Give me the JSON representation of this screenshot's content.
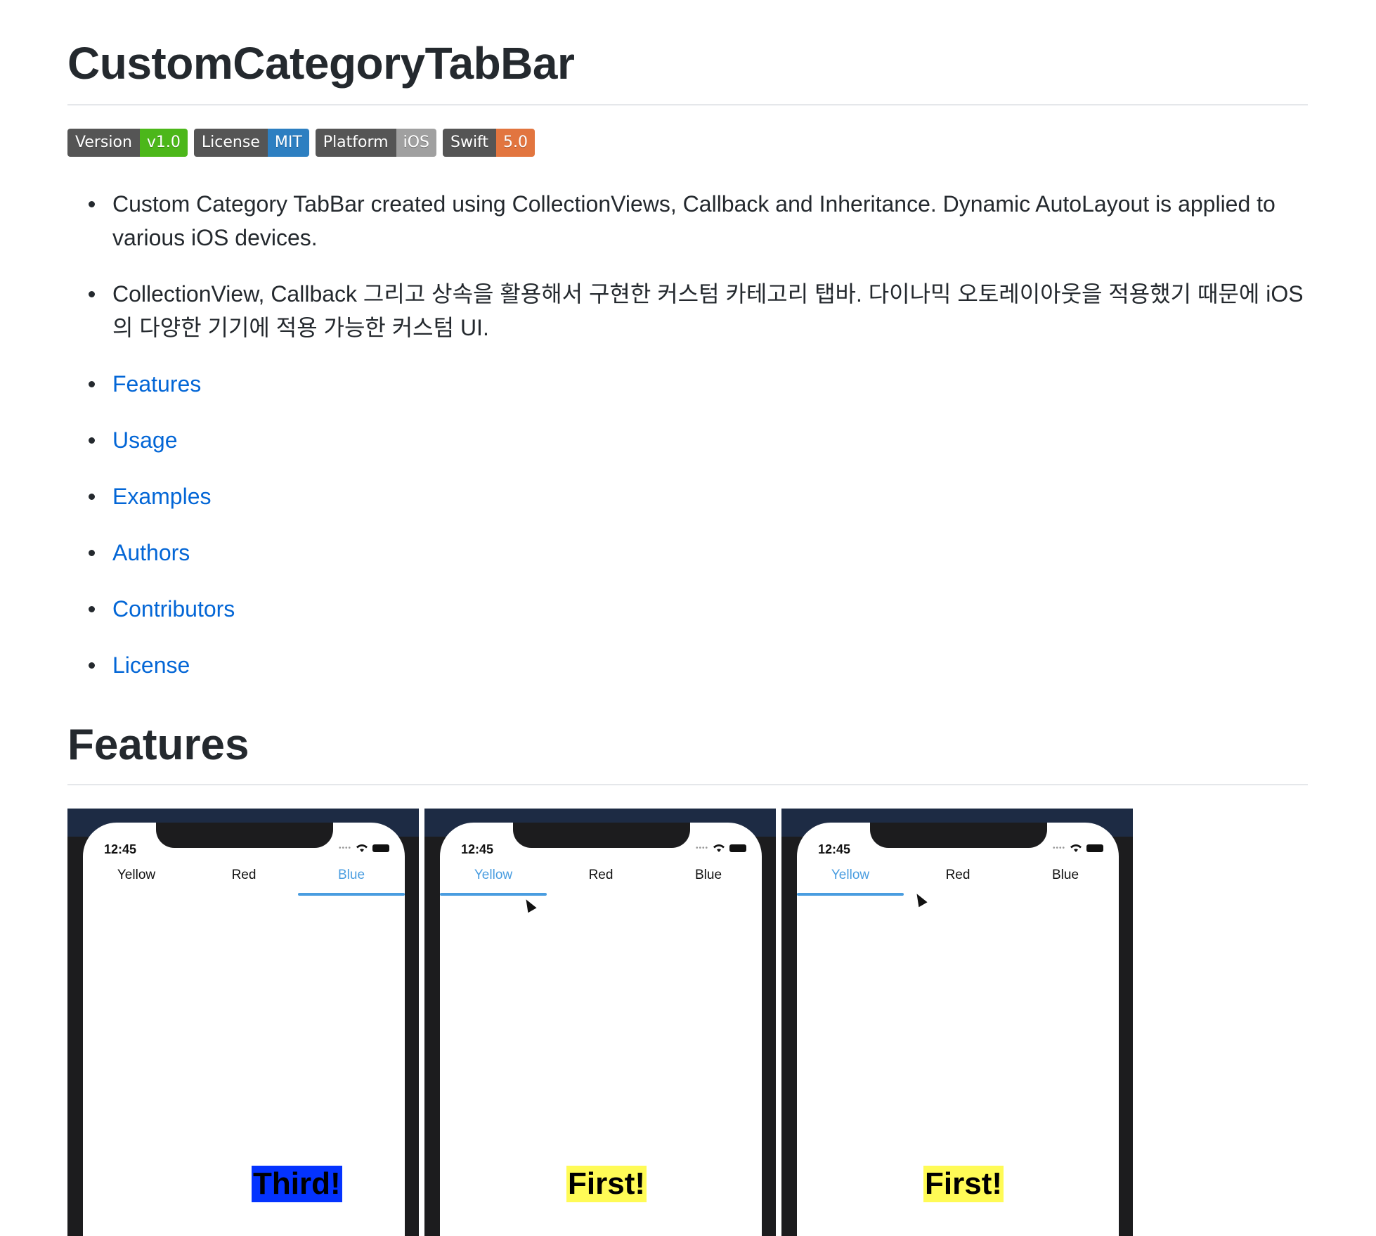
{
  "header": {
    "title": "CustomCategoryTabBar"
  },
  "badges": [
    {
      "label": "Version",
      "value": "v1.0",
      "color": "#4cb71a"
    },
    {
      "label": "License",
      "value": "MIT",
      "color": "#2d7fc1"
    },
    {
      "label": "Platform",
      "value": "iOS",
      "color": "#a0a0a0"
    },
    {
      "label": "Swift",
      "value": "5.0",
      "color": "#e2753f"
    }
  ],
  "description": {
    "english": "Custom Category TabBar created using CollectionViews, Callback and Inheritance. Dynamic AutoLayout is applied to various iOS devices.",
    "korean": "CollectionView, Callback 그리고 상속을 활용해서 구현한 커스텀 카테고리 탭바. 다이나믹 오토레이아웃을 적용했기 때문에 iOS의 다양한 기기에 적용 가능한 커스텀 UI."
  },
  "toc": [
    {
      "label": "Features"
    },
    {
      "label": "Usage"
    },
    {
      "label": "Examples"
    },
    {
      "label": "Authors"
    },
    {
      "label": "Contributors"
    },
    {
      "label": "License"
    }
  ],
  "features_section": {
    "title": "Features"
  },
  "phones": [
    {
      "time": "12:45",
      "tabs": [
        "Yellow",
        "Red",
        "Blue"
      ],
      "active_tab": 2,
      "content_label": "Third!",
      "content_color": "#0433ff"
    },
    {
      "time": "12:45",
      "tabs": [
        "Yellow",
        "Red",
        "Blue"
      ],
      "active_tab": 0,
      "content_label": "First!",
      "content_color": "#fffb56"
    },
    {
      "time": "12:45",
      "tabs": [
        "Yellow",
        "Red",
        "Blue"
      ],
      "active_tab": 0,
      "content_label": "First!",
      "content_color": "#fffb56"
    }
  ],
  "colors": {
    "link": "#0366d6",
    "text": "#24292e",
    "tab_active": "#4a9de0"
  }
}
